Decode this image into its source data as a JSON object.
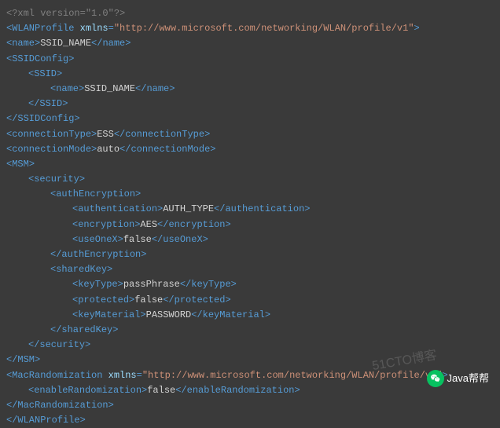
{
  "xml": {
    "declaration": "<?xml version=\"1.0\"?>",
    "root_open": "WLANProfile",
    "root_attr_name": "xmlns",
    "root_attr_val": "http://www.microsoft.com/networking/WLAN/profile/v1",
    "name_tag": "name",
    "name_val": "SSID_NAME",
    "ssidconfig": "SSIDConfig",
    "ssid": "SSID",
    "ssid_name_tag": "name",
    "ssid_name_val": "SSID_NAME",
    "conn_type_tag": "connectionType",
    "conn_type_val": "ESS",
    "conn_mode_tag": "connectionMode",
    "conn_mode_val": "auto",
    "msm": "MSM",
    "security": "security",
    "authenc": "authEncryption",
    "auth_tag": "authentication",
    "auth_val": "AUTH_TYPE",
    "enc_tag": "encryption",
    "enc_val": "AES",
    "useonex_tag": "useOneX",
    "useonex_val": "false",
    "sharedkey": "sharedKey",
    "keytype_tag": "keyType",
    "keytype_val": "passPhrase",
    "protected_tag": "protected",
    "protected_val": "false",
    "keymat_tag": "keyMaterial",
    "keymat_val": "PASSWORD",
    "macrand": "MacRandomization",
    "macrand_attr_name": "xmlns",
    "macrand_attr_val": "http://www.microsoft.com/networking/WLAN/profile/v3",
    "enablerand_tag": "enableRandomization",
    "enablerand_val": "false"
  },
  "watermark": "51CTO博客",
  "badge": "Java帮帮"
}
